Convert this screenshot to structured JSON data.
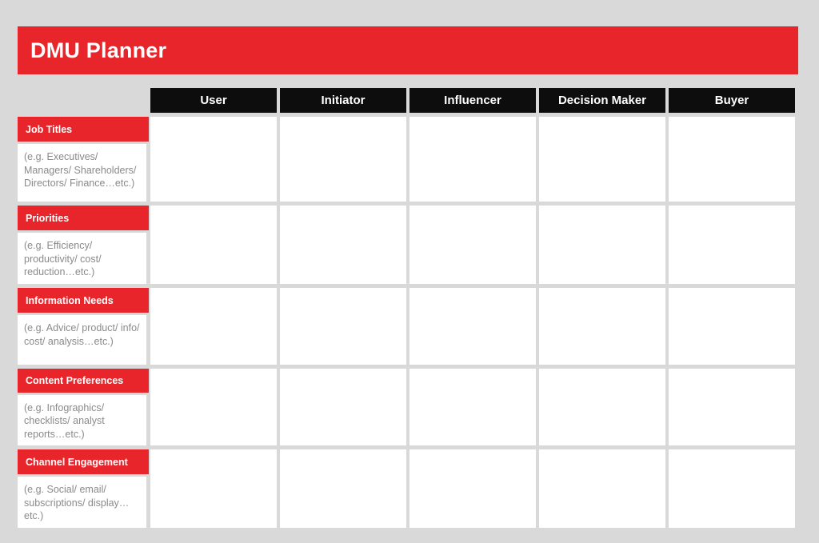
{
  "title": "DMU Planner",
  "theme": {
    "accent_red": "#e8252b",
    "header_black": "#0d0d0d",
    "page_background": "#d9d9d9",
    "cell_white": "#ffffff",
    "hint_gray": "#8a8a8a"
  },
  "columns": [
    {
      "label": "User"
    },
    {
      "label": "Initiator"
    },
    {
      "label": "Influencer"
    },
    {
      "label": "Decision Maker"
    },
    {
      "label": "Buyer"
    }
  ],
  "rows": [
    {
      "label": "Job Titles",
      "hint": "(e.g. Executives/ Managers/ Shareholders/ Directors/ Finance…etc.)",
      "cells": [
        "",
        "",
        "",
        "",
        ""
      ]
    },
    {
      "label": "Priorities",
      "hint": "(e.g. Efficiency/ productivity/ cost/ reduction…etc.)",
      "cells": [
        "",
        "",
        "",
        "",
        ""
      ]
    },
    {
      "label": "Information Needs",
      "hint": "(e.g. Advice/ product/ info/ cost/ analysis…etc.)",
      "cells": [
        "",
        "",
        "",
        "",
        ""
      ]
    },
    {
      "label": "Content Preferences",
      "hint": "(e.g. Infographics/ checklists/ analyst reports…etc.)",
      "cells": [
        "",
        "",
        "",
        "",
        ""
      ]
    },
    {
      "label": "Channel Engagement",
      "hint": "(e.g. Social/ email/ subscriptions/ display… etc.)",
      "cells": [
        "",
        "",
        "",
        "",
        ""
      ]
    }
  ]
}
